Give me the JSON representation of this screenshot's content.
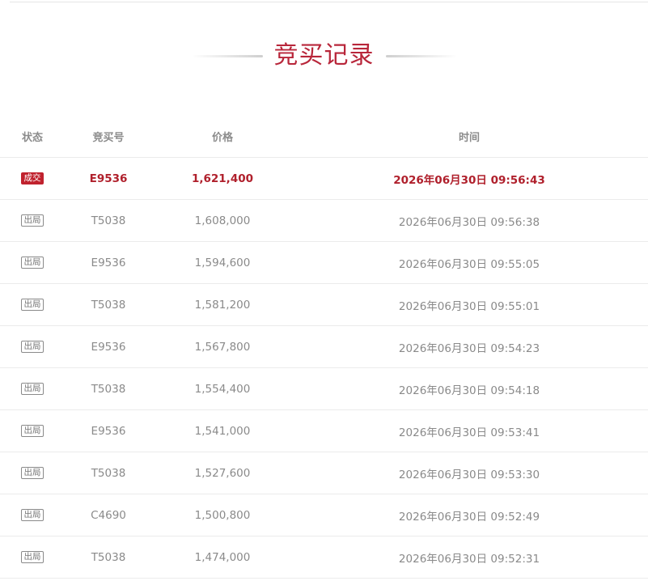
{
  "page": {
    "title": "竞买记录"
  },
  "table": {
    "headers": {
      "status": "状态",
      "bidder": "竞买号",
      "price": "价格",
      "time": "时间"
    },
    "rows": [
      {
        "status": "成交",
        "bidder": "E9536",
        "price": "1,621,400",
        "time": "2026年06月30日 09:56:43"
      },
      {
        "status": "出局",
        "bidder": "T5038",
        "price": "1,608,000",
        "time": "2026年06月30日 09:56:38"
      },
      {
        "status": "出局",
        "bidder": "E9536",
        "price": "1,594,600",
        "time": "2026年06月30日 09:55:05"
      },
      {
        "status": "出局",
        "bidder": "T5038",
        "price": "1,581,200",
        "time": "2026年06月30日 09:55:01"
      },
      {
        "status": "出局",
        "bidder": "E9536",
        "price": "1,567,800",
        "time": "2026年06月30日 09:54:23"
      },
      {
        "status": "出局",
        "bidder": "T5038",
        "price": "1,554,400",
        "time": "2026年06月30日 09:54:18"
      },
      {
        "status": "出局",
        "bidder": "E9536",
        "price": "1,541,000",
        "time": "2026年06月30日 09:53:41"
      },
      {
        "status": "出局",
        "bidder": "T5038",
        "price": "1,527,600",
        "time": "2026年06月30日 09:53:30"
      },
      {
        "status": "出局",
        "bidder": "C4690",
        "price": "1,500,800",
        "time": "2026年06月30日 09:52:49"
      },
      {
        "status": "出局",
        "bidder": "T5038",
        "price": "1,474,000",
        "time": "2026年06月30日 09:52:31"
      }
    ]
  },
  "colors": {
    "accent": "#b8263a",
    "winner_text": "#b0202c",
    "deal_badge_bg": "#c0222e",
    "muted_text": "#8a8a8a",
    "divider": "#ebebeb"
  }
}
